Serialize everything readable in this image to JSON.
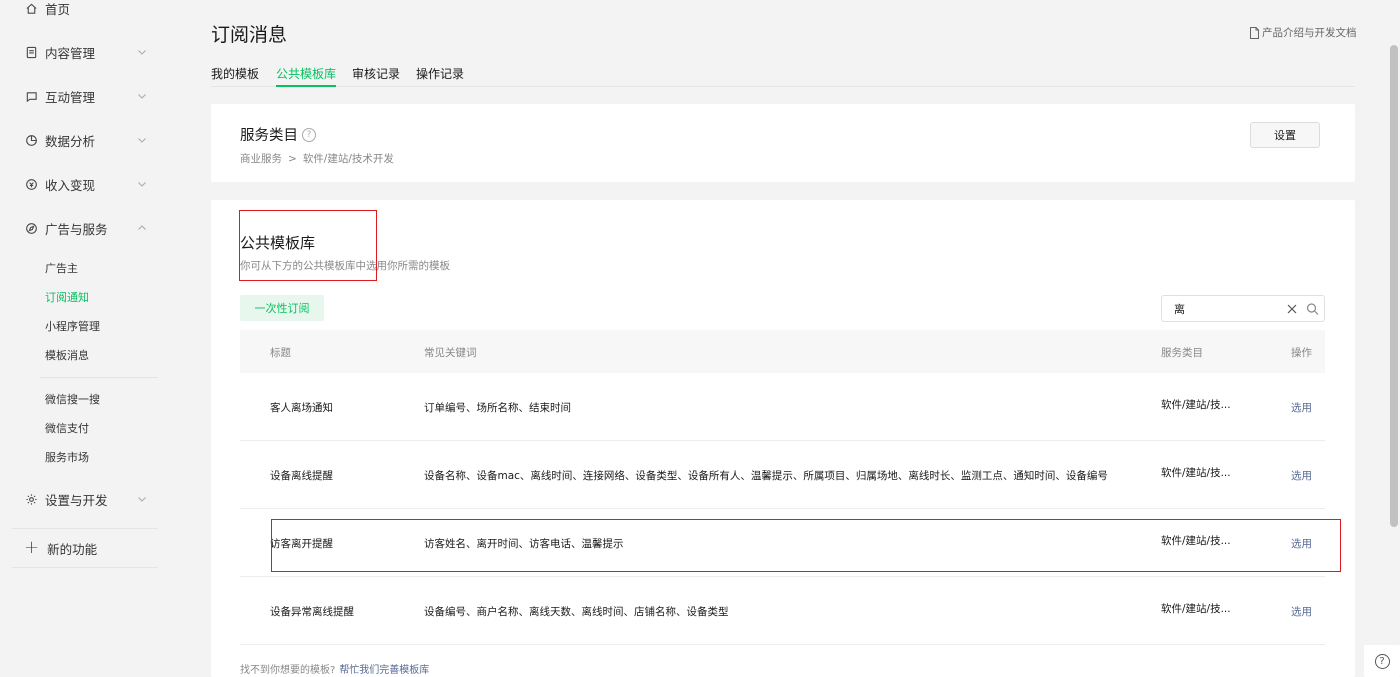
{
  "sidebar": {
    "home": "首页",
    "content": "内容管理",
    "interaction": "互动管理",
    "analytics": "数据分析",
    "monetize": "收入变现",
    "ads": "广告与服务",
    "ads_sub": [
      "广告主",
      "订阅通知",
      "小程序管理",
      "模板消息"
    ],
    "other_sub": [
      "微信搜一搜",
      "微信支付",
      "服务市场"
    ],
    "settings": "设置与开发",
    "new_features": "新的功能"
  },
  "header": {
    "title": "订阅消息",
    "doc_link": "产品介绍与开发文档",
    "tabs": [
      "我的模板",
      "公共模板库",
      "审核记录",
      "操作记录"
    ],
    "active_tab": "公共模板库"
  },
  "service_category": {
    "title": "服务类目",
    "help_icon": "?",
    "crumb_parent": "商业服务",
    "crumb_sep": ">",
    "crumb_child": "软件/建站/技术开发",
    "settings_button": "设置"
  },
  "library": {
    "title": "公共模板库",
    "description": "你可从下方的公共模板库中选用你所需的模板",
    "type_tag": "一次性订阅",
    "search_value": "离",
    "columns": [
      "标题",
      "常见关键词",
      "服务类目",
      "操作"
    ],
    "rows": [
      {
        "title": "客人离场通知",
        "keywords": "订单编号、场所名称、结束时间",
        "category": "软件/建站/技...",
        "action": "选用"
      },
      {
        "title": "设备离线提醒",
        "keywords": "设备名称、设备mac、离线时间、连接网络、设备类型、设备所有人、温馨提示、所属项目、归属场地、离线时长、监测工点、通知时间、设备编号",
        "category": "软件/建站/技...",
        "action": "选用"
      },
      {
        "title": "访客离开提醒",
        "keywords": "访客姓名、离开时间、访客电话、温馨提示",
        "category": "软件/建站/技...",
        "action": "选用"
      },
      {
        "title": "设备异常离线提醒",
        "keywords": "设备编号、商户名称、离线天数、离线时间、店铺名称、设备类型",
        "category": "软件/建站/技...",
        "action": "选用"
      }
    ],
    "footer_tip": "找不到你想要的模板?",
    "footer_link": "帮忙我们完善模板库"
  },
  "colors": {
    "accent": "#07c160",
    "link": "#576b95",
    "highlight": "#e0191e"
  }
}
